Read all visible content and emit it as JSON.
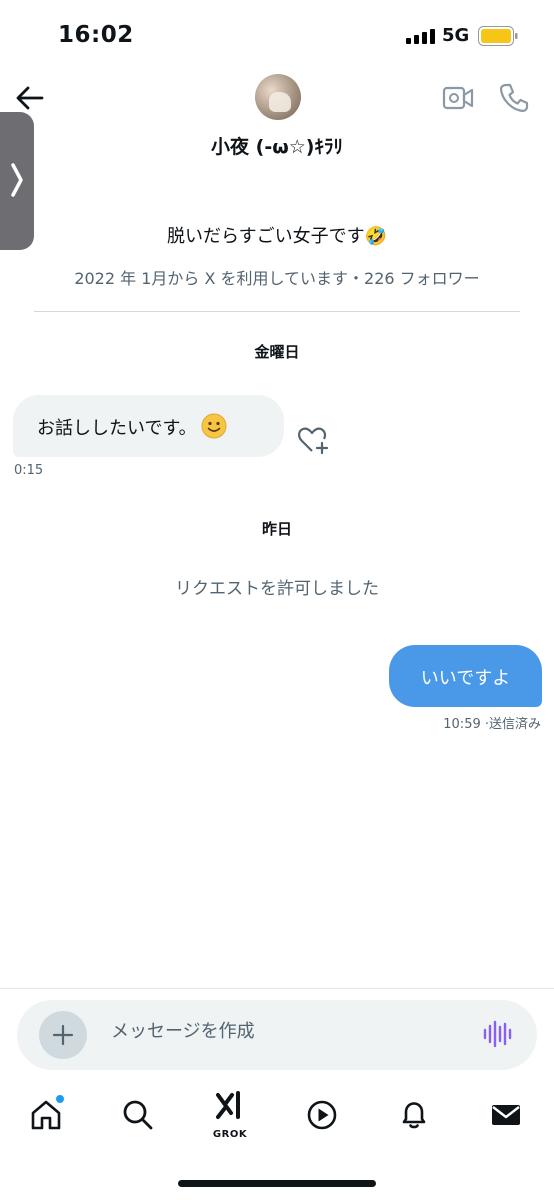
{
  "status_bar": {
    "time": "16:02",
    "network": "5G"
  },
  "header": {
    "name": "小夜 (-ω☆)ｷﾗﾘ"
  },
  "profile": {
    "bio": "脱いだらすごい女子です🤣",
    "joined": "2022 年 1月から X を利用しています・226 フォロワー"
  },
  "messages": {
    "day1": "金曜日",
    "incoming_text": "お話ししたいです。",
    "incoming_time": "0:15",
    "day2": "昨日",
    "request_note": "リクエストを許可しました",
    "outgoing_text": "いいですよ",
    "outgoing_meta": "10:59 ·送信済み"
  },
  "composer": {
    "placeholder": "メッセージを作成"
  },
  "tab_bar": {
    "grok_label": "GROK"
  },
  "icons": [
    "back-arrow-icon",
    "video-call-icon",
    "phone-icon",
    "add-reaction-icon",
    "plus-icon",
    "voice-icon",
    "home-icon",
    "search-icon",
    "grok-icon",
    "play-icon",
    "bell-icon",
    "mail-icon"
  ],
  "colors": {
    "accent": "#1d9bf0",
    "outgoing_bubble": "#4a99e9",
    "incoming_bubble": "#eff3f4",
    "voice_icon": "#8b5cf6"
  }
}
